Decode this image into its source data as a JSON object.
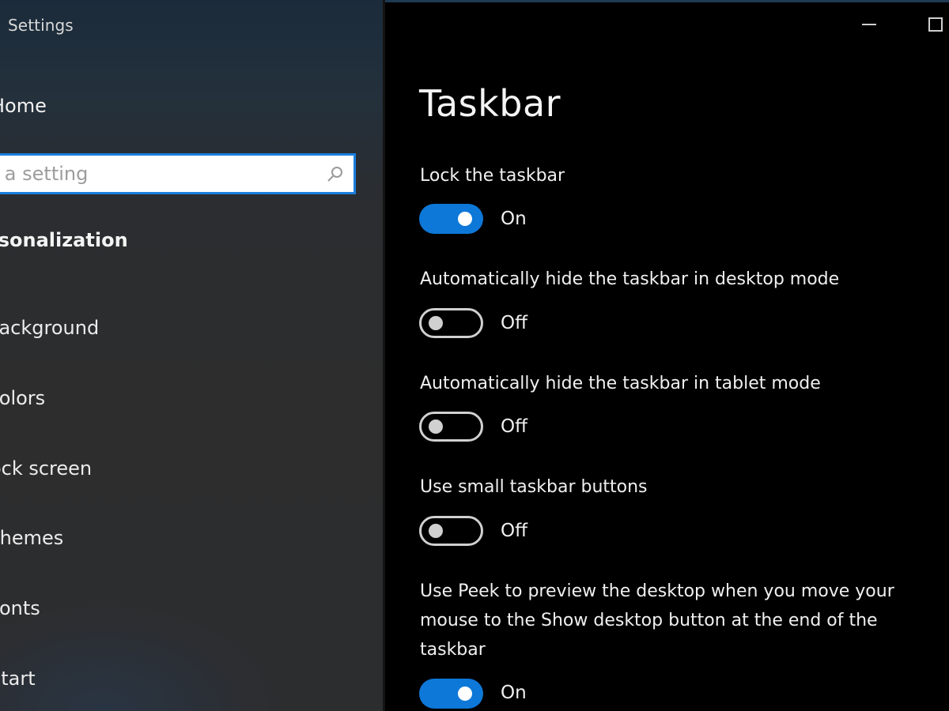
{
  "window": {
    "title": "Settings",
    "controls": {
      "minimize_icon": "minimize-icon",
      "maximize_icon": "maximize-icon"
    }
  },
  "sidebar": {
    "home_label": "Home",
    "search": {
      "placeholder": "Find a setting",
      "value": "",
      "icon": "search-icon"
    },
    "section_title": "Personalization",
    "items": [
      {
        "label": "Background"
      },
      {
        "label": "Colors"
      },
      {
        "label": "Lock screen"
      },
      {
        "label": "Themes"
      },
      {
        "label": "Fonts"
      },
      {
        "label": "Start"
      }
    ]
  },
  "main": {
    "title": "Taskbar",
    "settings": [
      {
        "label": "Lock the taskbar",
        "state": "on",
        "state_label": "On"
      },
      {
        "label": "Automatically hide the taskbar in desktop mode",
        "state": "off",
        "state_label": "Off"
      },
      {
        "label": "Automatically hide the taskbar in tablet mode",
        "state": "off",
        "state_label": "Off"
      },
      {
        "label": "Use small taskbar buttons",
        "state": "off",
        "state_label": "Off"
      },
      {
        "label": "Use Peek to preview the desktop when you move your mouse to the Show desktop button at the end of the taskbar",
        "state": "on",
        "state_label": "On"
      }
    ]
  },
  "colors": {
    "accent": "#0d78d8",
    "sidebar_bg": "#2d2d2d",
    "main_bg": "#000000"
  }
}
